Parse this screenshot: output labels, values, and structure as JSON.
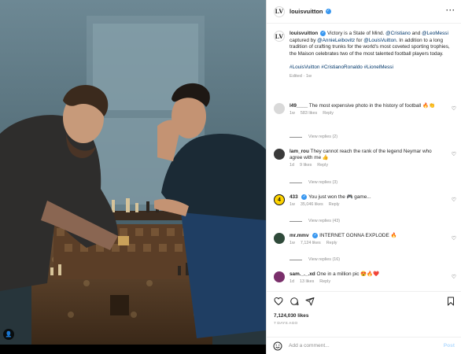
{
  "account": {
    "username": "louisvuitton",
    "logo_text": "LV"
  },
  "caption": {
    "username": "louisvuitton",
    "part1": " Victory is a State of Mind. ",
    "tag1": "@Cristiano",
    "part2": " and ",
    "tag2": "@LeoMessi",
    "part3": " captured by ",
    "tag3": "@AnnieLeibovitz",
    "part4": " for ",
    "tag4": "@LouisVuitton",
    "part5": ". In addition to a long tradition of crafting trunks for the world's most coveted sporting trophies, the Maison celebrates two of the most talented football players today.",
    "hashtags": "#LouisVuitton #CristianoRonaldo #LionelMessi",
    "edited": "Edited · 1w"
  },
  "comments": [
    {
      "user": "l49____",
      "text": "The most expensive photo in the history of football 🔥👏",
      "time": "1w",
      "likes": "583 likes",
      "reply": "Reply",
      "view_replies": "View replies (2)",
      "avatar_color": "#d9d9d9"
    },
    {
      "user": "lam_rou",
      "text": "They cannot reach the rank of the legend Neymar who agree with me 👍",
      "time": "1d",
      "likes": "9 likes",
      "reply": "Reply",
      "view_replies": "View replies (3)",
      "avatar_color": "#3a3a3a"
    },
    {
      "user": "433",
      "text": "You just won the 🎮 game...",
      "time": "1w",
      "likes": "35,046 likes",
      "reply": "Reply",
      "view_replies": "View replies (43)",
      "avatar_color": "#ffd400"
    },
    {
      "user": "mr.mmv",
      "text": "INTERNET GONNA EXPLODE 🔥",
      "time": "1w",
      "likes": "7,124 likes",
      "reply": "Reply",
      "view_replies": "View replies (16)",
      "avatar_color": "#2f4a3a"
    },
    {
      "user": "sam._._.xd",
      "text": "One in a million pic 😍🔥❤️",
      "time": "1d",
      "likes": "13 likes",
      "reply": "Reply",
      "view_replies": "",
      "avatar_color": "#7a2f6b"
    }
  ],
  "stats": {
    "likes": "7,124,030 likes",
    "date": "7 DAYS AGO"
  },
  "composer": {
    "placeholder": "Add a comment...",
    "post_label": "Post"
  },
  "icons": [
    "more-icon",
    "verified-icon",
    "heart-icon",
    "comment-icon",
    "share-icon",
    "bookmark-icon",
    "emoji-icon",
    "tagged-user-icon"
  ]
}
